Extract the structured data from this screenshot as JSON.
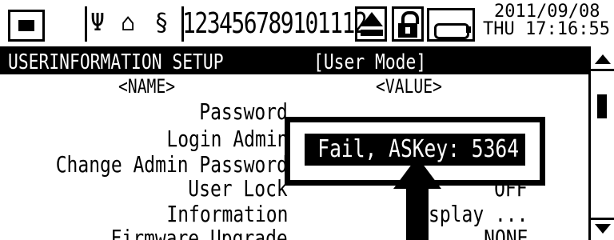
{
  "status_bar": {
    "channels": "123456789101112",
    "date": "2011/09/08",
    "day_time": "THU 17:16:55",
    "icons": {
      "usb": "usb-icon",
      "storage": "storage-icon",
      "key": "key-icon",
      "upload": "upload-icon",
      "lock": "lock-icon",
      "battery": "battery-icon"
    }
  },
  "title_bar": {
    "title": "USERINFORMATION SETUP",
    "mode": "[User Mode]"
  },
  "columns": {
    "name": "<NAME>",
    "value": "<VALUE>"
  },
  "rows": [
    {
      "name": "Password",
      "value": ""
    },
    {
      "name": "Login Admin",
      "value": ""
    },
    {
      "name": "Change Admin Password",
      "value": ""
    },
    {
      "name": "User Lock",
      "value": "OFF"
    },
    {
      "name": "Information",
      "value": "Display ..."
    },
    {
      "name": "Firmware Upgrade",
      "value": "NONE"
    }
  ],
  "callout": {
    "text": "Fail, ASKey: 5364"
  },
  "colors": {
    "foreground": "#000000",
    "background": "#ffffff"
  }
}
